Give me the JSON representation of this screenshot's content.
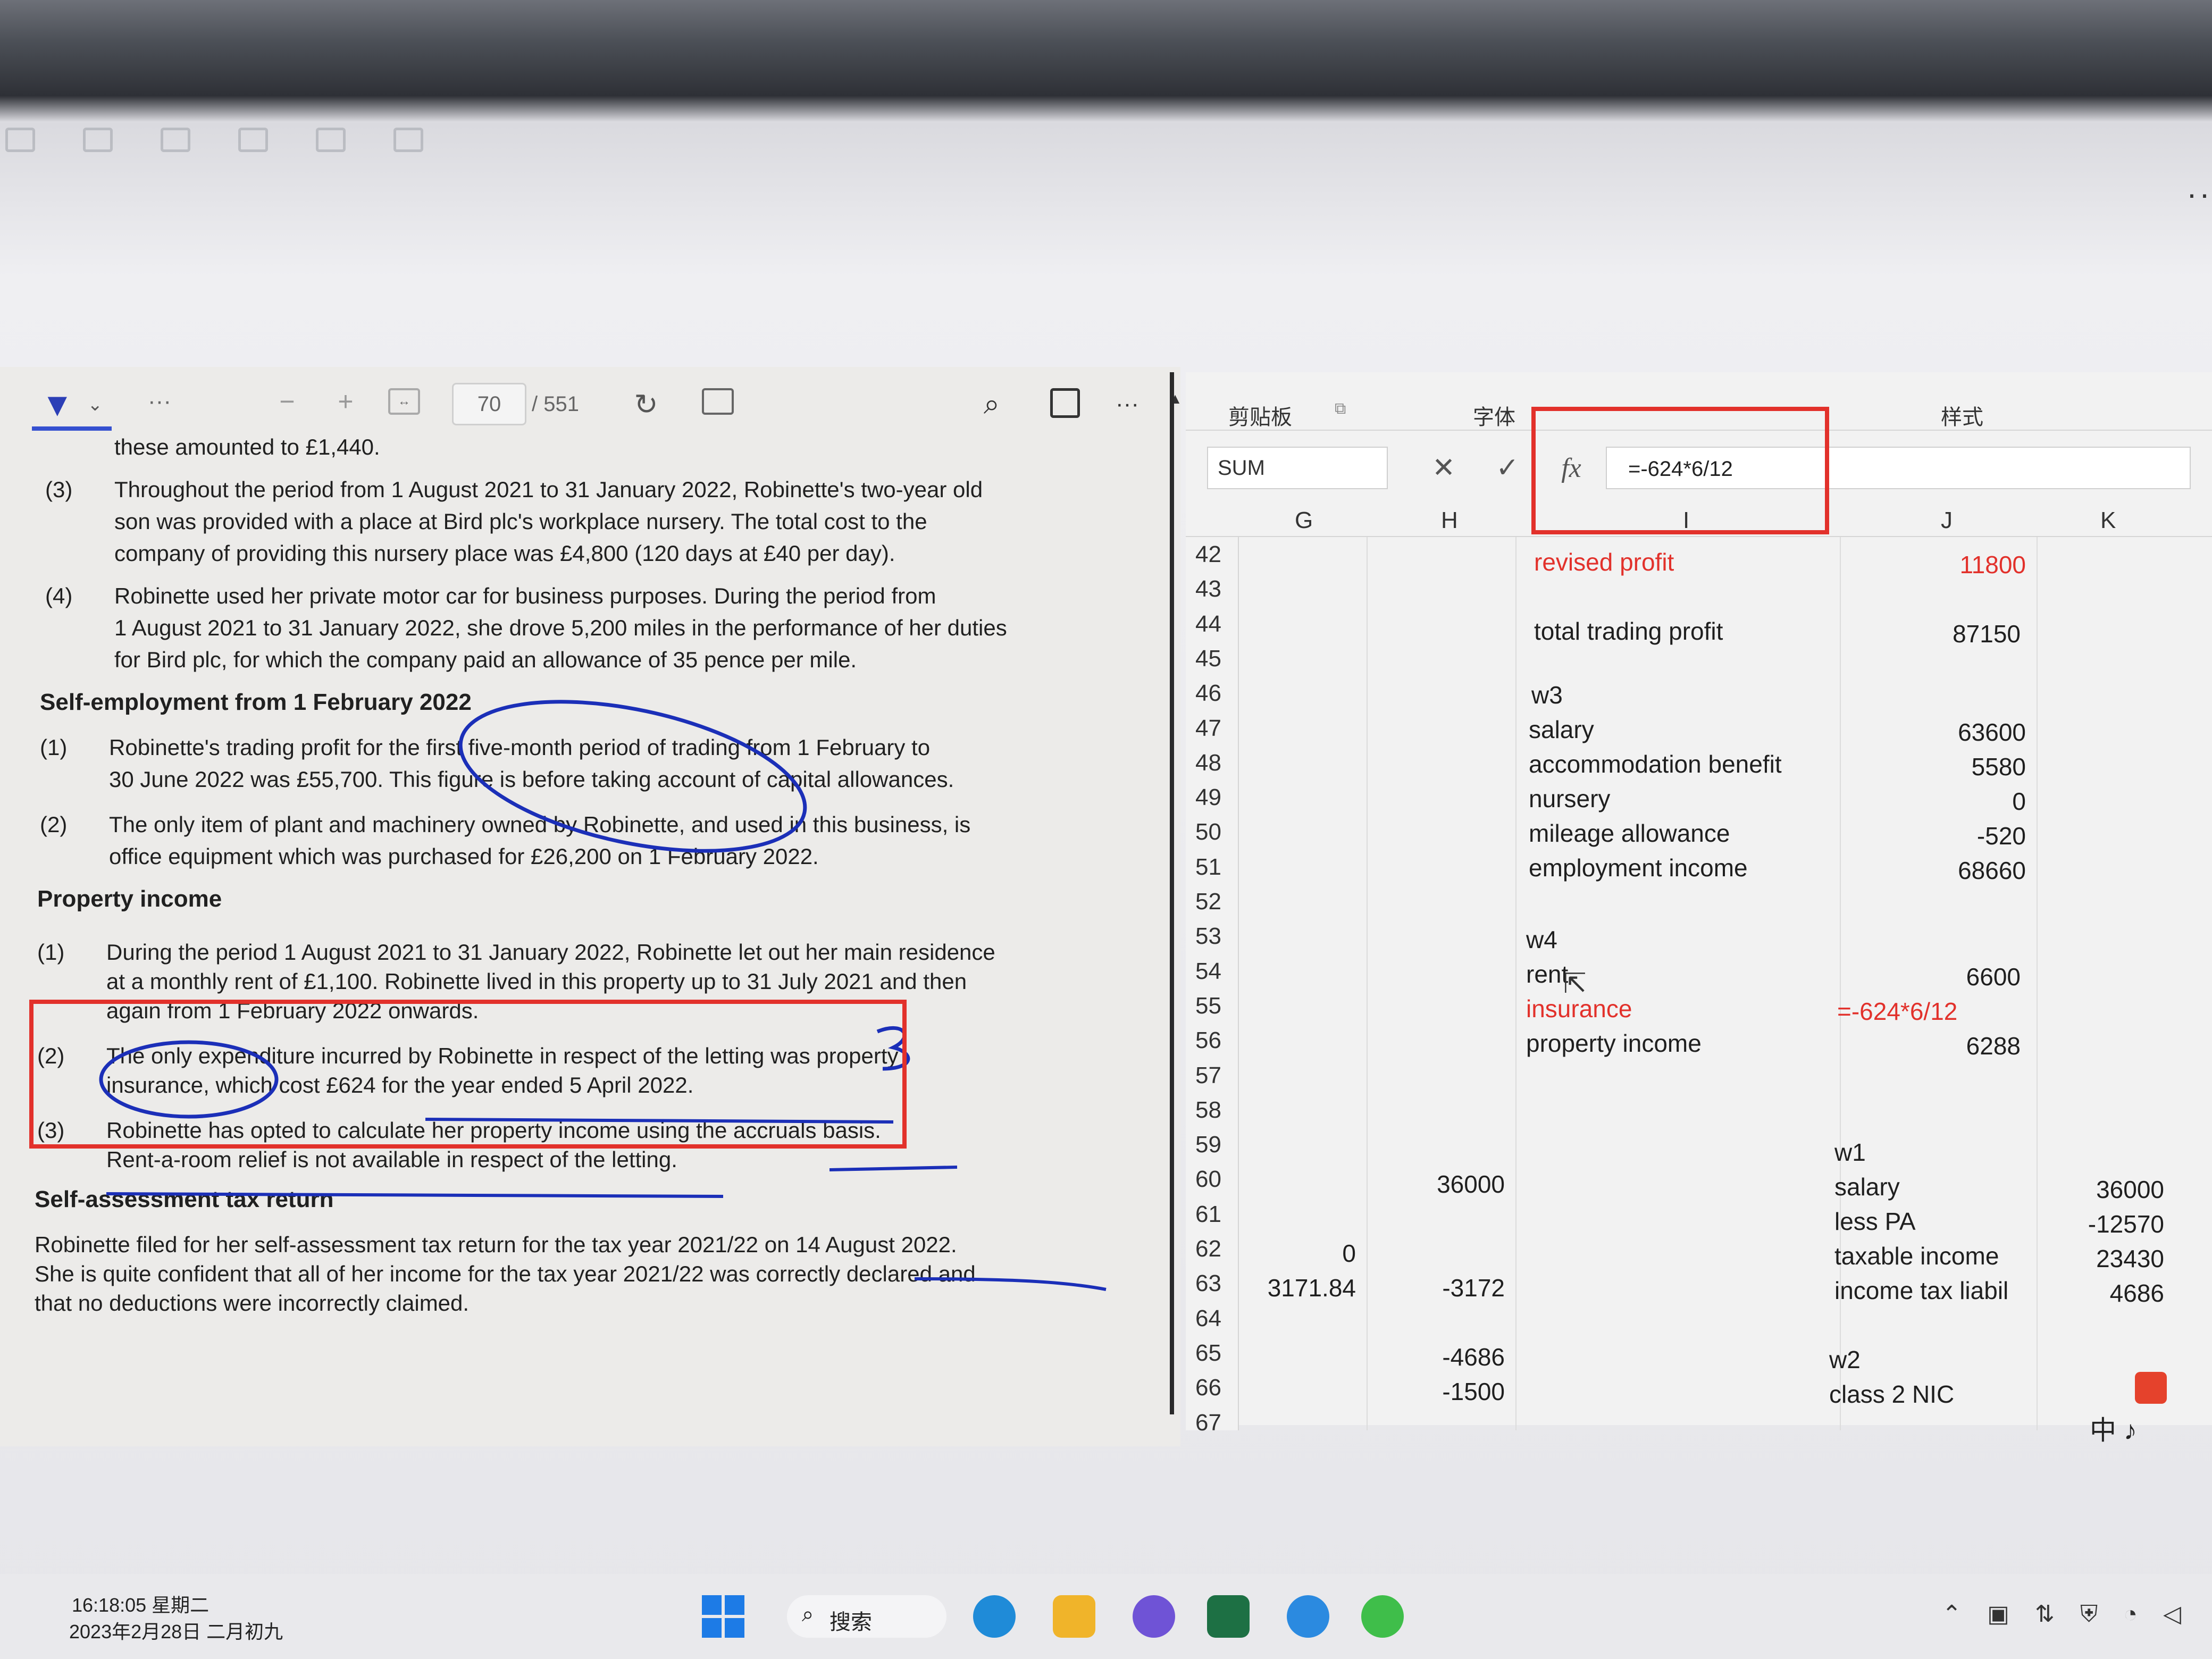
{
  "pdf": {
    "page_number": "70",
    "page_total": "/ 551",
    "lines": [
      "these amounted to £1,440.",
      "Throughout the period from 1 August 2021 to 31 January 2022, Robinette's two-year old",
      "son was provided with a place at Bird plc's workplace nursery.  The total cost to the",
      "company of providing this nursery place was £4,800 (120 days at £40 per day).",
      "Robinette used her private motor car for business purposes.  During the period from",
      "1 August 2021 to 31 January 2022, she drove 5,200 miles in the performance of her duties",
      "for Bird plc, for which the company paid an allowance of 35 pence per mile.",
      "Robinette's trading profit for the first five-month period of trading from 1 February to",
      "30 June 2022 was £55,700.  This figure is before taking account of capital allowances.",
      "The only item of plant and machinery owned by Robinette, and used in this business, is",
      "office equipment which was purchased for £26,200 on 1 February 2022.",
      "During the period 1 August 2021 to 31 January 2022, Robinette let out her main residence",
      "at a monthly rent of £1,100.  Robinette lived in this property up to 31 July 2021 and then",
      "again from 1 February 2022 onwards.",
      "The only expenditure incurred by Robinette in respect of the letting was property",
      "insurance, which cost £624 for the year ended 5 April 2022.",
      "Robinette has opted to calculate her property income using the accruals basis.",
      "Rent-a-room relief is not available in respect of the letting.",
      "Robinette filed for her self-assessment tax return for the tax year 2021/22 on 14 August 2022.",
      "She is quite confident that all of her income for the tax year 2021/22 was correctly declared and",
      "that no deductions were incorrectly claimed."
    ],
    "numbers": [
      "(3)",
      "(4)",
      "(1)",
      "(2)",
      "(1)",
      "(2)",
      "(3)"
    ],
    "headings": [
      "Self-employment from 1 February 2022",
      "Property income",
      "Self-assessment tax return"
    ]
  },
  "excel": {
    "ribbon": {
      "clipboard": "剪贴板",
      "font": "字体",
      "styles": "样式"
    },
    "name_box": "SUM",
    "formula": "=-624*6/12",
    "columns": [
      "G",
      "H",
      "I",
      "J",
      "K"
    ],
    "rows": [
      "42",
      "43",
      "44",
      "45",
      "46",
      "47",
      "48",
      "49",
      "50",
      "51",
      "52",
      "53",
      "54",
      "55",
      "56",
      "57",
      "58",
      "59",
      "60",
      "61",
      "62",
      "63",
      "64",
      "65",
      "66",
      "67"
    ],
    "cells": {
      "r42": {
        "label": "revised profit",
        "value": "11800"
      },
      "r44": {
        "label": "total trading profit",
        "value": "87150"
      },
      "r46": {
        "label": "w3"
      },
      "r47": {
        "label": "salary",
        "value": "63600"
      },
      "r48": {
        "label": "accommodation benefit",
        "value": "5580"
      },
      "r49": {
        "label": "nursery",
        "value": "0"
      },
      "r50": {
        "label": "mileage allowance",
        "value": "-520"
      },
      "r51": {
        "label": "employment income",
        "value": "68660"
      },
      "r53": {
        "label": "w4"
      },
      "r54": {
        "label": "rent",
        "value": "6600"
      },
      "r55": {
        "label": "insurance",
        "value": "=-624*6/12"
      },
      "r56": {
        "label": "property income",
        "value": "6288"
      },
      "r59": {
        "label": "w1"
      },
      "r60": {
        "h": "36000",
        "label": "salary",
        "value": "36000"
      },
      "r61": {
        "label": "less PA",
        "value": "-12570"
      },
      "r62": {
        "g": "0",
        "label": "taxable income",
        "value": "23430"
      },
      "r63": {
        "g": "3171.84",
        "h": "-3172",
        "label": "income tax liabil",
        "value": "4686"
      },
      "r65": {
        "h": "-4686",
        "label": "w2"
      },
      "r66": {
        "h": "-1500",
        "label": "class 2 NIC"
      }
    }
  },
  "taskbar": {
    "time": "16:18:05 星期二",
    "date": "2023年2月28日 二月初九",
    "search": "搜索"
  }
}
